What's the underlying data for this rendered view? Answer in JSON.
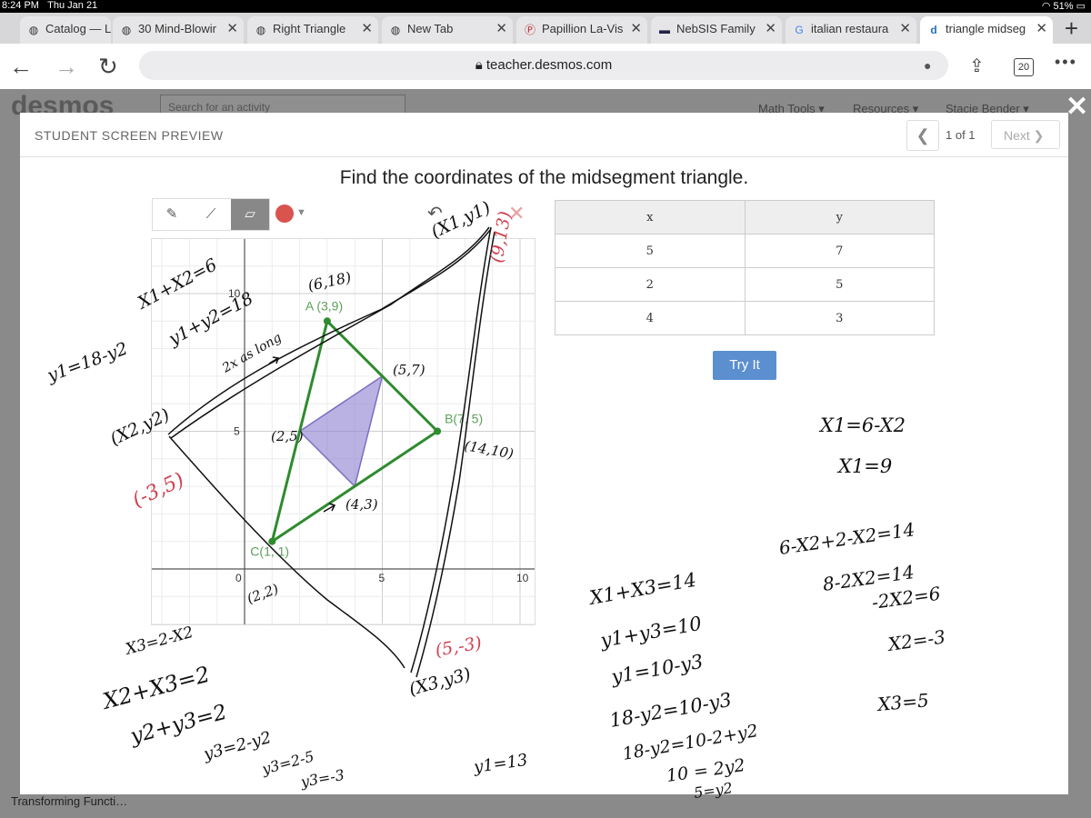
{
  "status": {
    "time": "8:24 PM",
    "date": "Thu Jan 21",
    "battery": "51%"
  },
  "tabs": [
    {
      "label": "Catalog — L",
      "favicon": "globe-icon"
    },
    {
      "label": "30 Mind-Blowir",
      "favicon": "globe-icon"
    },
    {
      "label": "Right Triangle",
      "favicon": "globe-icon"
    },
    {
      "label": "New Tab",
      "favicon": "globe-icon"
    },
    {
      "label": "Papillion La-Vis",
      "favicon": "pl-icon"
    },
    {
      "label": "NebSIS Family",
      "favicon": "nebsis-icon"
    },
    {
      "label": "italian restaura",
      "favicon": "google-icon"
    },
    {
      "label": "triangle midseg",
      "favicon": "desmos-icon"
    }
  ],
  "url": "teacher.desmos.com",
  "tab_count": "20",
  "background": {
    "logo": "desmos",
    "search_placeholder": "Search for an activity",
    "menu": [
      "Math Tools ▾",
      "Resources ▾",
      "Stacie Bender ▾"
    ],
    "footer": "Transforming Functi…"
  },
  "modal": {
    "title": "STUDENT SCREEN PREVIEW",
    "page_count": "1 of 1",
    "next_label": "Next",
    "prompt": "Find the coordinates of the midsegment triangle.",
    "try_label": "Try It"
  },
  "graph": {
    "x_ticks": [
      "0",
      "5",
      "10"
    ],
    "y_ticks": [
      "10",
      "5"
    ],
    "points": [
      {
        "label": "A (3,9)",
        "x": 3,
        "y": 9
      },
      {
        "label": "B(7, 5)",
        "x": 7,
        "y": 5
      },
      {
        "label": "C(1, 1)",
        "x": 1,
        "y": 1
      }
    ],
    "midsegment": [
      {
        "x": 5,
        "y": 7
      },
      {
        "x": 2,
        "y": 5
      },
      {
        "x": 4,
        "y": 3
      }
    ]
  },
  "table": {
    "headers": [
      "x",
      "y"
    ],
    "rows": [
      [
        "5",
        "7"
      ],
      [
        "2",
        "5"
      ],
      [
        "4",
        "3"
      ]
    ]
  },
  "handwriting": [
    "X1+X2=6",
    "y1+y2=18",
    "y1=18-y2",
    "(X1,y1)",
    "(9,13)",
    "(6,18)",
    "2x as long",
    "(X2,y2)",
    "(-3,5)",
    "(5,7)",
    "(2,5)",
    "(14,10)",
    "(4,3)",
    "(2,2)",
    "(X3,y3)",
    "(5,-3)",
    "X1=6-X2",
    "X1=9",
    "6-X2+2-X2=14",
    "8-2X2=14",
    "-2X2=6",
    "X2=-3",
    "X1+X3=14",
    "y1+y3=10",
    "y1=10-y3",
    "18-y2=10-y3",
    "18-y2=10-2+y2",
    "10 = 2y2",
    "5=y2",
    "X3=5",
    "X3=2-X2",
    "X2+X3=2",
    "y2+y3=2",
    "y3=2-y2",
    "y3=2-5",
    "y3=-3",
    "y1=13"
  ],
  "colors": {
    "accent": "#5b8fd0",
    "triangle": "#2e8b2e",
    "midsegment": "#8b7fd0",
    "ink_red": "#d04050"
  }
}
